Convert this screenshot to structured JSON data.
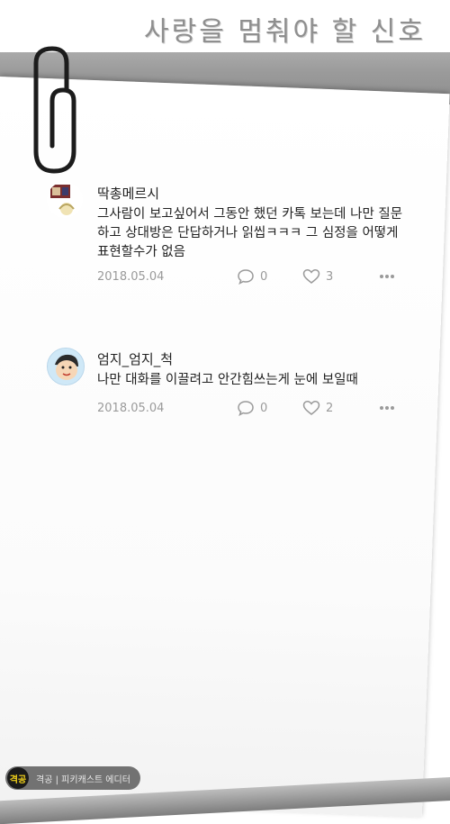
{
  "header": {
    "title": "사랑을 멈춰야 할 신호"
  },
  "comments": [
    {
      "username": "딱총메르시",
      "text": "그사람이 보고싶어서 그동안 했던 카톡 보는데 나만 질문하고 상대방은 단답하거나 읽씹ㅋㅋㅋ 그 심정을 어떻게 표현할수가 없음",
      "date": "2018.05.04",
      "comment_count": "0",
      "like_count": "3"
    },
    {
      "username": "엄지_엄지_척",
      "text": "나만 대화를 이끌려고 안간힘쓰는게 눈에 보일때",
      "date": "2018.05.04",
      "comment_count": "0",
      "like_count": "2"
    }
  ],
  "icons": {
    "paperclip": "paperclip-icon",
    "comment": "speech-bubble-icon",
    "like": "heart-icon",
    "more": "ellipsis-icon"
  },
  "watermark": {
    "logo_text": "격공",
    "text": "격공 | 피키캐스트 에디터"
  },
  "colors": {
    "band": "#9a9a9a",
    "meta": "#9a9a9a",
    "text": "#222222",
    "logo": "#f3d21a"
  }
}
